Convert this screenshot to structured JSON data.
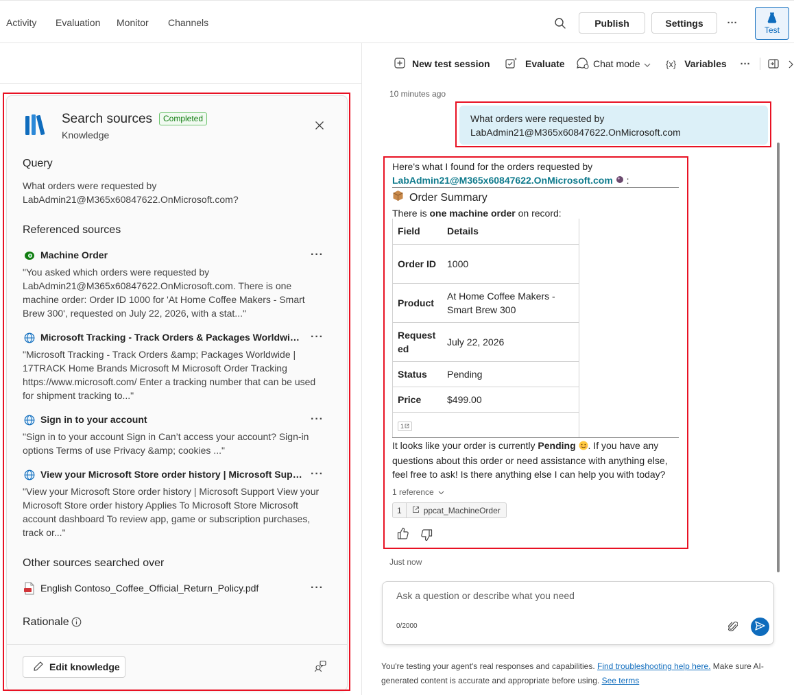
{
  "nav": {
    "items": [
      "Activity",
      "Evaluation",
      "Monitor",
      "Channels"
    ],
    "publish": "Publish",
    "settings": "Settings",
    "more": "···",
    "test": "Test"
  },
  "toolbar": {
    "new_session": "New test session",
    "evaluate": "Evaluate",
    "chat_mode": "Chat mode",
    "variables": "Variables",
    "more": "···"
  },
  "panel": {
    "title": "Search sources",
    "badge": "Completed",
    "subtitle": "Knowledge",
    "query_heading": "Query",
    "query_text": "What orders were requested by LabAdmin21@M365x60847622.OnMicrosoft.com?",
    "referenced_heading": "Referenced sources",
    "sources": [
      {
        "title": "Machine Order",
        "icon": "dataverse-icon",
        "excerpt": "\"You asked which orders were requested by LabAdmin21@M365x60847622.OnMicrosoft.com. There is one machine order: Order ID 1000 for 'At Home Coffee Makers - Smart Brew 300', requested on July 22, 2026, with a stat...\""
      },
      {
        "title": "Microsoft Tracking - Track Orders & Packages Worldwide | ...",
        "icon": "globe-icon",
        "excerpt": "\"Microsoft Tracking - Track Orders &amp; Packages Worldwide | 17TRACK Home Brands Microsoft M Microsoft Order Tracking https://www.microsoft.com/ Enter a tracking number that can be used for shipment tracking to...\""
      },
      {
        "title": "Sign in to your account",
        "icon": "globe-icon",
        "excerpt": "\"Sign in to your account Sign in Can’t access your account? Sign-in options Terms of use Privacy &amp; cookies ...\""
      },
      {
        "title": "View your Microsoft Store order history | Microsoft Support",
        "icon": "globe-icon",
        "excerpt": "\"View your Microsoft Store order history | Microsoft Support View your Microsoft Store order history Applies To Microsoft Store Microsoft account dashboard To review app, game or subscription purchases, track or...\""
      }
    ],
    "other_heading": "Other sources searched over",
    "other_file": "English Contoso_Coffee_Official_Return_Policy.pdf",
    "rationale_heading": "Rationale",
    "edit_button": "Edit knowledge",
    "more": "···"
  },
  "chat": {
    "time_top": "10 minutes ago",
    "user_message": "What orders were requested by LabAdmin21@M365x60847622.OnMicrosoft.com",
    "resp_intro": "Here's what I found for the orders requested by",
    "resp_email": "LabAdmin21@M365x60847622.OnMicrosoft.com",
    "resp_colon": ":",
    "summary_title": "Order Summary",
    "summary_pre": "There is ",
    "summary_bold": "one machine order",
    "summary_post": " on record:",
    "table_headers": [
      "Field",
      "Details"
    ],
    "table_rows": [
      {
        "field": "Order ID",
        "value": "1000"
      },
      {
        "field": "Product",
        "value": "At Home Coffee Makers - Smart Brew 300"
      },
      {
        "field": "Requested",
        "value": "July 22, 2026"
      },
      {
        "field": "Status",
        "value": "Pending"
      },
      {
        "field": "Price",
        "value": "$499.00"
      }
    ],
    "cite_num": "1",
    "closing_pre": "It looks like your order is currently ",
    "closing_bold": "Pending",
    "closing_post": ". If you have any questions about this order or need assistance with anything else, feel free to ask! Is there anything else I can help you with today?",
    "reference_toggle": "1 reference",
    "reference_num": "1",
    "reference_name": "ppcat_MachineOrder",
    "time_bottom": "Just now",
    "composer_placeholder": "Ask a question or describe what you need",
    "char_count": "0/2000",
    "disclaimer_pre": "You're testing your agent's real responses and capabilities. ",
    "disclaimer_link1": "Find troubleshooting help here.",
    "disclaimer_mid": " Make sure AI-generated content is accurate and appropriate before using. ",
    "disclaimer_link2": "See terms"
  },
  "colors": {
    "accent": "#0f6cbd",
    "highlight": "#e81123",
    "user_bubble": "#dcf0f8",
    "badge_green": "#107c10"
  }
}
